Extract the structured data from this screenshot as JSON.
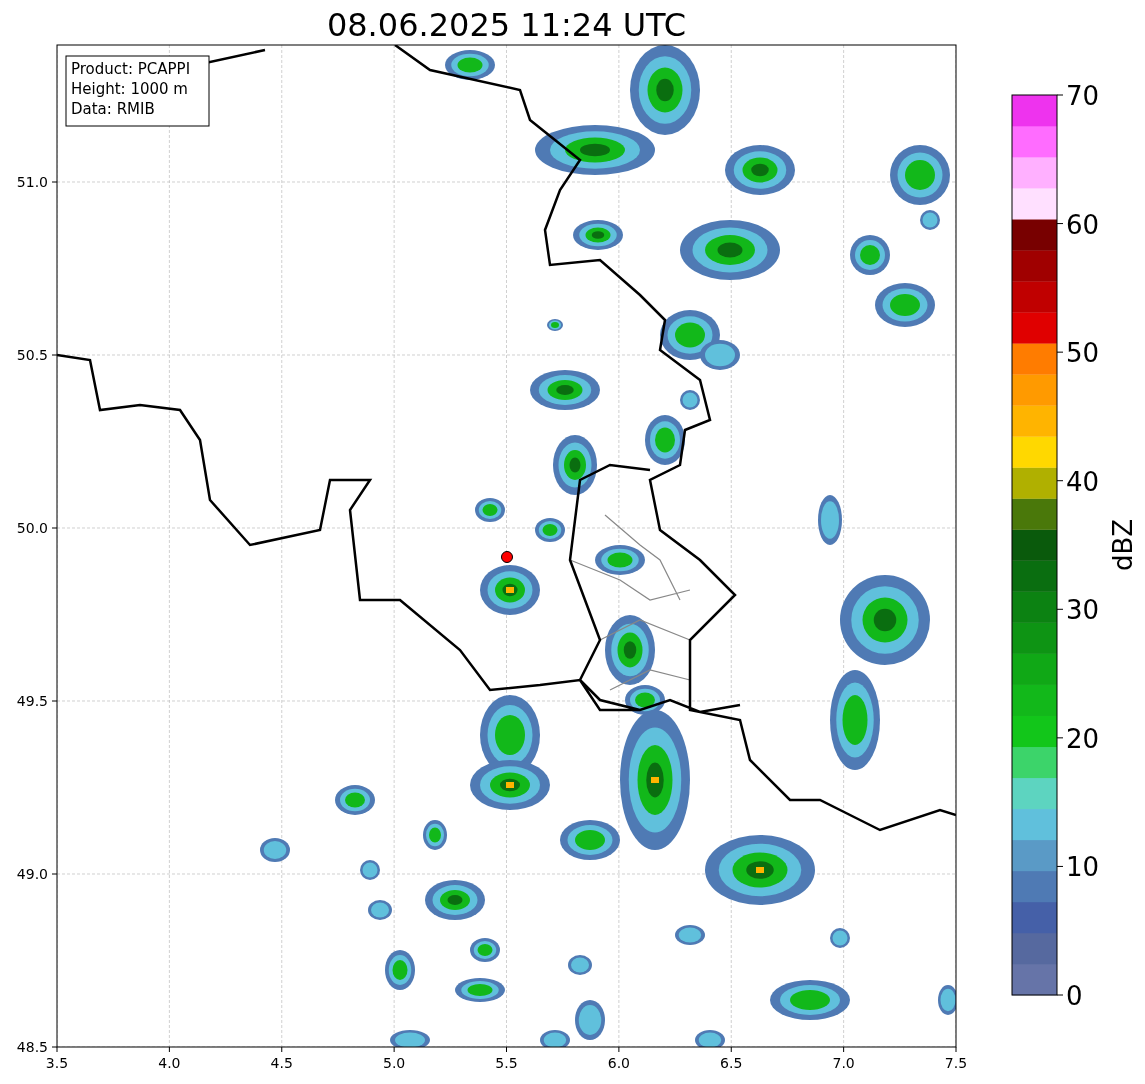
{
  "title": "08.06.2025 11:24 UTC",
  "map": {
    "legend": [
      "Product: PCAPPI",
      "Height: 1000 m",
      "Data: RMIB"
    ],
    "xticks": [
      "3.5",
      "4.0",
      "4.5",
      "5.0",
      "5.5",
      "6.0",
      "6.5",
      "7.0",
      "7.5"
    ],
    "yticks": [
      "51.0",
      "50.5",
      "50.0",
      "49.5",
      "49.0",
      "48.5"
    ]
  },
  "colorbar": {
    "label": "dBZ",
    "ticks": [
      "70",
      "60",
      "50",
      "40",
      "30",
      "20",
      "10",
      "0"
    ],
    "bands": [
      {
        "color": "#6674a8"
      },
      {
        "color": "#56699f"
      },
      {
        "color": "#4560a8"
      },
      {
        "color": "#4f7ab4"
      },
      {
        "color": "#5a9ac6"
      },
      {
        "color": "#60c0dc"
      },
      {
        "color": "#5dd4c0"
      },
      {
        "color": "#3cd46a"
      },
      {
        "color": "#12c61a"
      },
      {
        "color": "#12b81a"
      },
      {
        "color": "#10a816"
      },
      {
        "color": "#0e9414"
      },
      {
        "color": "#0c8212"
      },
      {
        "color": "#0a6e10"
      },
      {
        "color": "#0a5a0c"
      },
      {
        "color": "#4a780a"
      },
      {
        "color": "#b0b000"
      },
      {
        "color": "#ffd800"
      },
      {
        "color": "#ffb400"
      },
      {
        "color": "#ff9a00"
      },
      {
        "color": "#ff7c00"
      },
      {
        "color": "#e00000"
      },
      {
        "color": "#c00000"
      },
      {
        "color": "#a00000"
      },
      {
        "color": "#780000"
      },
      {
        "color": "#ffe0ff"
      },
      {
        "color": "#ffb0ff"
      },
      {
        "color": "#ff6cff"
      },
      {
        "color": "#ee33ee"
      }
    ]
  }
}
